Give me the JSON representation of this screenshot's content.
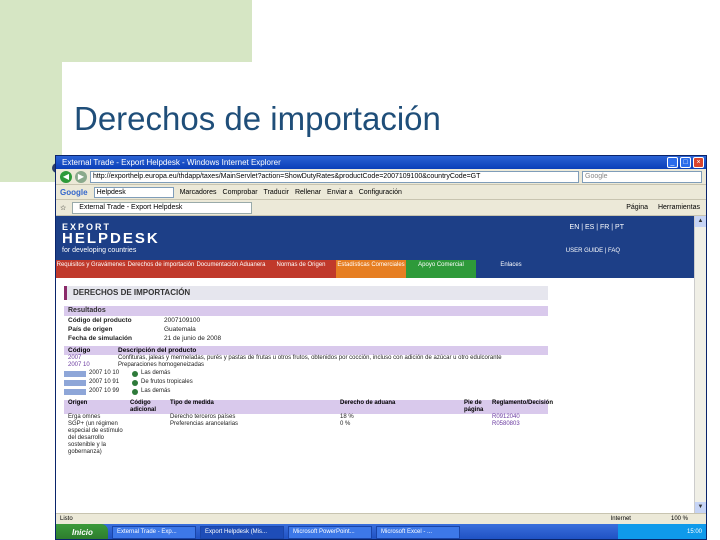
{
  "slide": {
    "title": "Derechos de importación"
  },
  "browser": {
    "window_title": "External Trade - Export Helpdesk - Windows Internet Explorer",
    "address": "http://exporthelp.europa.eu/thdapp/taxes/MainServlet?action=ShowDutyRates&productCode=2007109100&countryCode=GT",
    "search_placeholder": "Google",
    "google_input": "Helpdesk",
    "google_links": [
      "Marcadores",
      "Comprobar",
      "Traducir",
      "Rellenar",
      "Enviar a",
      "Configuración"
    ],
    "tab_label": "External Trade - Export Helpdesk",
    "tab_tools": [
      "Página",
      "Herramientas"
    ]
  },
  "site": {
    "logo_top": "EXPORT",
    "logo_main": "HELPDESK",
    "logo_sub": "for developing countries",
    "languages": "EN | ES | FR | PT",
    "user_guide": "USER GUIDE | FAQ",
    "nav": [
      "Requisitos y Gravámenes",
      "Derechos de importación",
      "Documentación Aduanera",
      "Normas de Origen",
      "Estadísticas Comerciales",
      "Apoyo Comercial",
      "Enlaces"
    ]
  },
  "page": {
    "heading": "DERECHOS DE IMPORTACIÓN",
    "results_label": "Resultados",
    "fields": [
      {
        "k": "Código del producto",
        "v": "2007109100"
      },
      {
        "k": "País de origen",
        "v": "Guatemala"
      },
      {
        "k": "Fecha de simulación",
        "v": "21 de junio de 2008"
      }
    ],
    "desc_headers": [
      "Código",
      "Descripción del producto"
    ],
    "desc_rows": [
      {
        "code": "2007",
        "desc": "Confituras, jaleas y mermeladas, purés y pastas de frutas u otros frutos, obtenidos por cocción, incluso con adición de azúcar u otro edulcorante"
      },
      {
        "code": "2007 10",
        "desc": "Preparaciones homogeneizadas"
      }
    ],
    "tree": [
      {
        "code": "2007 10 10",
        "desc": "Las demás"
      },
      {
        "code": "2007 10 91",
        "desc": "De frutos tropicales"
      },
      {
        "code": "2007 10 99",
        "desc": "Las demás"
      }
    ],
    "duty_headers": [
      "Origen",
      "Código adicional",
      "Tipo de medida",
      "Derecho de aduana",
      "Pie de página",
      "Reglamento/Decisión"
    ],
    "duty_rows": [
      {
        "origin": "Erga omnes",
        "code": "",
        "type": "Derecho terceros países",
        "duty": "18 %",
        "foot": "",
        "reg": "R0912040"
      },
      {
        "origin": "SGP+ (un régimen especial de estímulo del desarrollo sostenible y la gobernanza)",
        "code": "",
        "type": "Preferencias arancelarias",
        "duty": "0 %",
        "foot": "",
        "reg": "R0580803"
      }
    ]
  },
  "statusbar": {
    "left": "Listo",
    "zone": "Internet",
    "zoom": "100 %"
  },
  "taskbar": {
    "start": "Inicio",
    "items": [
      "External Trade - Exp...",
      "Export Helpdesk (Mis...",
      "Microsoft PowerPoint...",
      "Microsoft Excel - ..."
    ],
    "clock": "15:00"
  }
}
